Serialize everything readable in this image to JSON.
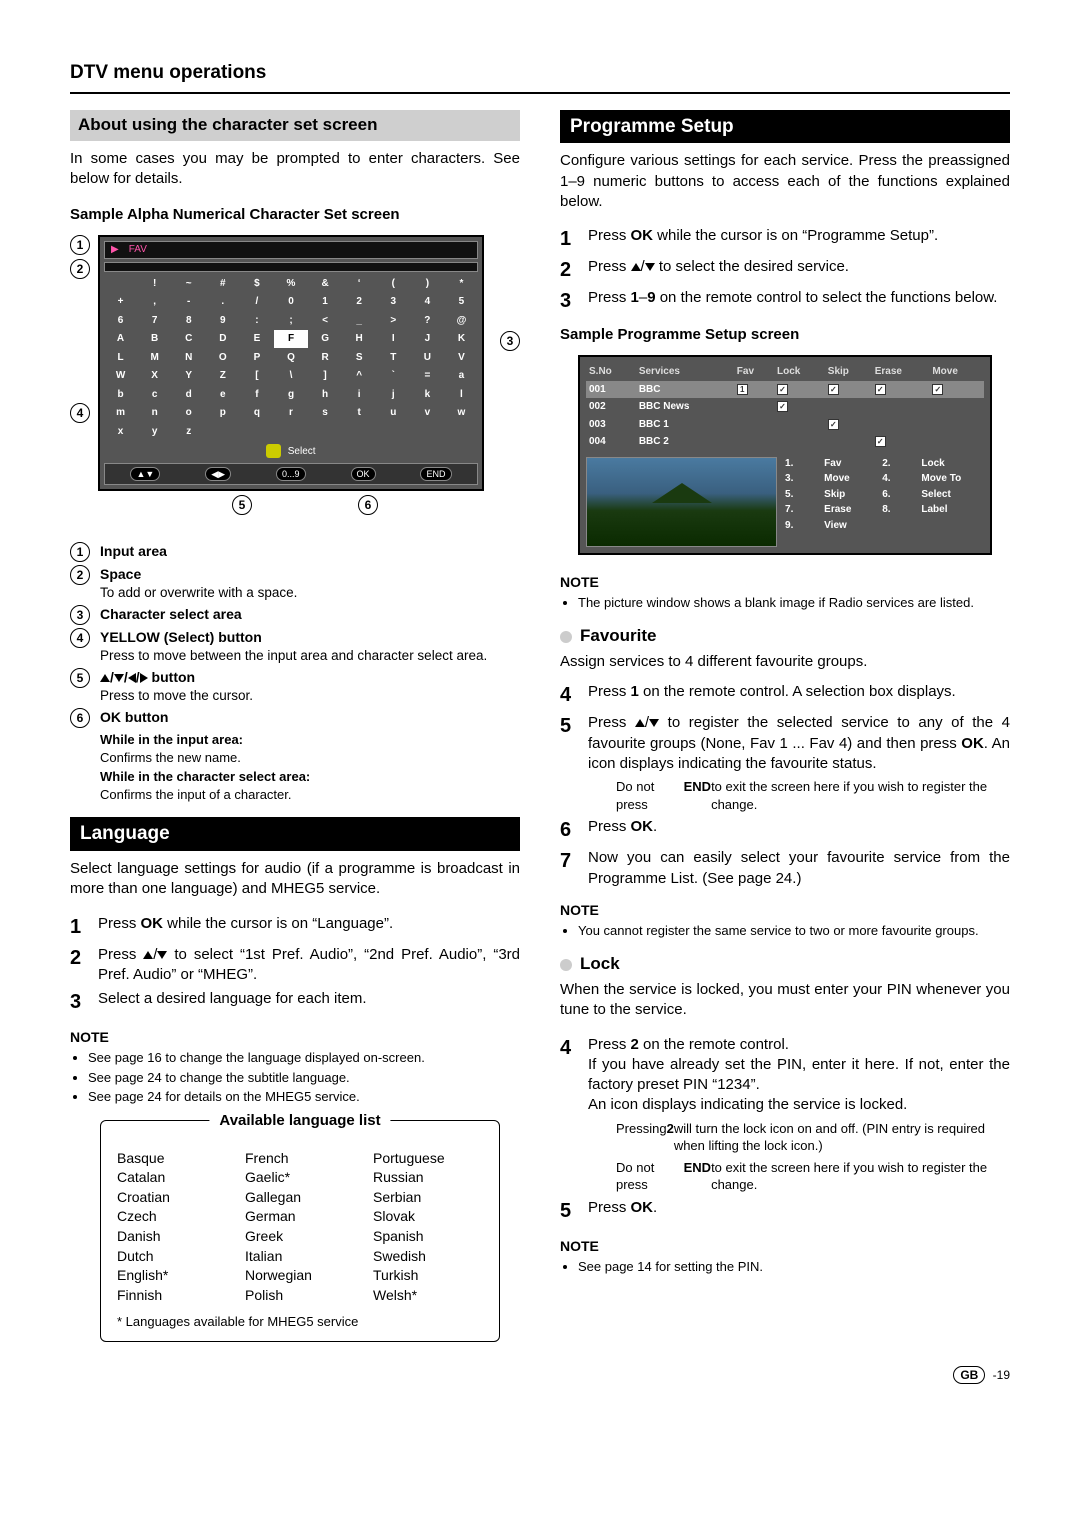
{
  "page_title": "DTV menu operations",
  "footer": {
    "region": "GB",
    "page": "-19"
  },
  "left": {
    "graybar": "About using the character set screen",
    "intro": "In some cases you may be prompted to enter characters. See below for details.",
    "sample_heading": "Sample Alpha Numerical Character Set screen",
    "osd": {
      "input_icon": "▶",
      "input_text": "FAV",
      "grid": [
        [
          "",
          "!",
          "~",
          "#",
          "$",
          "%",
          "&",
          "‘",
          "(",
          ")",
          "*"
        ],
        [
          "+",
          ",",
          "-",
          ".",
          "/",
          "0",
          "1",
          "2",
          "3",
          "4",
          "5"
        ],
        [
          "6",
          "7",
          "8",
          "9",
          ":",
          ";",
          "<",
          "_",
          ">",
          "?",
          "@"
        ],
        [
          "A",
          "B",
          "C",
          "D",
          "E",
          "F",
          "G",
          "H",
          "I",
          "J",
          "K"
        ],
        [
          "L",
          "M",
          "N",
          "O",
          "P",
          "Q",
          "R",
          "S",
          "T",
          "U",
          "V"
        ],
        [
          "W",
          "X",
          "Y",
          "Z",
          "[",
          "\\",
          "]",
          "^",
          "`",
          "=",
          "a"
        ],
        [
          "b",
          "c",
          "d",
          "e",
          "f",
          "g",
          "h",
          "i",
          "j",
          "k",
          "l"
        ],
        [
          "m",
          "n",
          "o",
          "p",
          "q",
          "r",
          "s",
          "t",
          "u",
          "v",
          "w"
        ],
        [
          "x",
          "y",
          "z",
          "",
          "",
          "",
          "",
          "",
          "",
          "",
          ""
        ]
      ],
      "select_label": "Select",
      "buttons": {
        "nav1": "▲▼",
        "nav2": "◀▶",
        "num": "0...9",
        "ok": "OK",
        "end": "END"
      }
    },
    "defs": [
      {
        "n": "1",
        "title": "Input area",
        "desc": ""
      },
      {
        "n": "2",
        "title": "Space",
        "desc": "To add or overwrite with a space."
      },
      {
        "n": "3",
        "title": "Character select area",
        "desc": ""
      },
      {
        "n": "4",
        "title": "YELLOW (Select) button",
        "desc": "Press to move between the input area and character select area."
      },
      {
        "n": "5",
        "title_html": "▲/▼/◀/▶ button",
        "desc": "Press to move the cursor."
      },
      {
        "n": "6",
        "title": "OK button",
        "desc": "",
        "subs": [
          {
            "bt": "While in the input area:",
            "d": "Confirms the new name."
          },
          {
            "bt": "While in the character select area:",
            "d": "Confirms the input of a character."
          }
        ]
      }
    ],
    "lang_heading": "Language",
    "lang_intro": "Select language settings for audio (if a programme is broadcast in more than one language) and MHEG5 service.",
    "lang_steps": [
      {
        "n": "1",
        "html": "Press <b>OK</b> while the cursor is on “Language”."
      },
      {
        "n": "2",
        "html": "Press ▲/▼ to select “1st Pref. Audio”, “2nd Pref. Audio”, “3rd Pref. Audio” or “MHEG”."
      },
      {
        "n": "3",
        "html": "Select a desired language for each item."
      }
    ],
    "note_label": "NOTE",
    "lang_notes": [
      "See page 16 to change the language displayed on-screen.",
      "See page 24 to change the subtitle language.",
      "See page 24 for details on the MHEG5 service."
    ],
    "langbox_title": "Available language list",
    "languages": {
      "col1": [
        "Basque",
        "Catalan",
        "Croatian",
        "Czech",
        "Danish",
        "Dutch",
        "English*",
        "Finnish"
      ],
      "col2": [
        "French",
        "Gaelic*",
        "Gallegan",
        "German",
        "Greek",
        "Italian",
        "Norwegian",
        "Polish"
      ],
      "col3": [
        "Portuguese",
        "Russian",
        "Serbian",
        "Slovak",
        "Spanish",
        "Swedish",
        "Turkish",
        "Welsh*"
      ]
    },
    "langbox_foot": "* Languages available for MHEG5 service"
  },
  "right": {
    "blackbar": "Programme Setup",
    "intro": "Configure various settings for each service. Press the preassigned 1–9 numeric buttons to access each of the functions explained below.",
    "steps": [
      {
        "n": "1",
        "html": "Press <b>OK</b> while the cursor is on “Programme Setup”."
      },
      {
        "n": "2",
        "html": "Press ▲/▼ to select the desired service."
      },
      {
        "n": "3",
        "html": "Press <b>1</b>–<b>9</b> on the remote control to select the functions below."
      }
    ],
    "sample_heading": "Sample Programme Setup screen",
    "ps": {
      "head": [
        "S.No",
        "Services",
        "Fav",
        "Lock",
        "Skip",
        "Erase",
        "Move"
      ],
      "rows": [
        {
          "no": "001",
          "svc": "BBC",
          "fav": "1",
          "lock": true,
          "skip": true,
          "erase": true,
          "move": true,
          "sel": true
        },
        {
          "no": "002",
          "svc": "BBC News",
          "lock": true
        },
        {
          "no": "003",
          "svc": "BBC 1",
          "skip": true
        },
        {
          "no": "004",
          "svc": "BBC 2",
          "erase": true
        }
      ],
      "keys": [
        [
          "1.",
          "Fav",
          "2.",
          "Lock"
        ],
        [
          "3.",
          "Move",
          "4.",
          "Move To"
        ],
        [
          "5.",
          "Skip",
          "6.",
          "Select"
        ],
        [
          "7.",
          "Erase",
          "8.",
          "Label"
        ],
        [
          "9.",
          "View",
          "",
          ""
        ]
      ]
    },
    "ps_note_label": "NOTE",
    "ps_notes": [
      "The picture window shows a blank image if Radio services are listed."
    ],
    "fav_heading": "Favourite",
    "fav_intro": "Assign services to 4 different favourite groups.",
    "fav_steps": [
      {
        "n": "4",
        "html": "Press <b>1</b> on the remote control. A selection box displays."
      },
      {
        "n": "5",
        "html": "Press ▲/▼ to register the selected service to any of the 4 favourite groups (None, Fav 1 ... Fav 4) and then press <b>OK</b>. An icon displays indicating the favourite status.",
        "sub": [
          "Do not press <b>END</b> to exit the screen here if you wish to register the change."
        ]
      },
      {
        "n": "6",
        "html": "Press <b>OK</b>."
      },
      {
        "n": "7",
        "html": "Now you can easily select your favourite service from the Programme List. (See page 24.)"
      }
    ],
    "fav_note_label": "NOTE",
    "fav_notes": [
      "You cannot register the same service to two or more favourite groups."
    ],
    "lock_heading": "Lock",
    "lock_intro": "When the service is locked, you must enter your PIN whenever you tune to the service.",
    "lock_steps": [
      {
        "n": "4",
        "html": "Press <b>2</b> on the remote control.<br>If you have already set the PIN, enter it here. If not, enter the factory preset PIN “1234”.<br>An icon displays indicating the service is locked.",
        "sub": [
          "Pressing <b>2</b> will turn the lock icon on and off. (PIN entry is required when lifting the lock icon.)",
          "Do not press <b>END</b> to exit the screen here if you wish to register the change."
        ]
      },
      {
        "n": "5",
        "html": "Press <b>OK</b>."
      }
    ],
    "lock_note_label": "NOTE",
    "lock_notes": [
      "See page 14 for setting the PIN."
    ]
  }
}
